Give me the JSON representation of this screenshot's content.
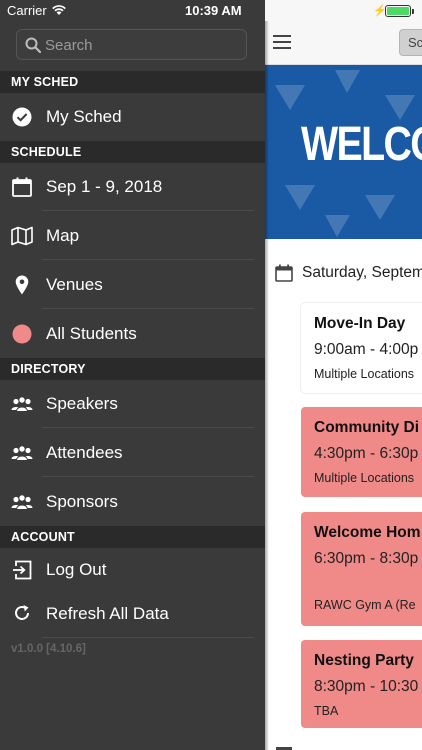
{
  "status_bar": {
    "carrier": "Carrier",
    "time": "10:39 AM",
    "battery_color": "#4cd964"
  },
  "drawer": {
    "search": {
      "placeholder": "Search",
      "icon": "search-icon"
    },
    "sections": {
      "my_sched": {
        "header": "MY SCHED",
        "items": [
          {
            "label": "My Sched",
            "icon": "checkmark-circle-icon"
          }
        ]
      },
      "schedule": {
        "header": "SCHEDULE",
        "items": [
          {
            "label": "Sep 1 - 9, 2018",
            "icon": "calendar-icon"
          },
          {
            "label": "Map",
            "icon": "map-icon"
          },
          {
            "label": "Venues",
            "icon": "location-pin-icon"
          },
          {
            "label": "All Students",
            "icon": "color-dot-icon",
            "dot_color": "#f08a88"
          }
        ]
      },
      "directory": {
        "header": "DIRECTORY",
        "items": [
          {
            "label": "Speakers",
            "icon": "people-icon"
          },
          {
            "label": "Attendees",
            "icon": "people-icon"
          },
          {
            "label": "Sponsors",
            "icon": "people-icon"
          }
        ]
      },
      "account": {
        "header": "ACCOUNT",
        "items": [
          {
            "label": "Log Out",
            "icon": "logout-icon"
          },
          {
            "label": "Refresh All Data",
            "icon": "refresh-icon"
          }
        ]
      }
    },
    "version": "v1.0.0 [4.10.6]"
  },
  "main": {
    "topbar_button": "Sc",
    "banner_text": "WELCO",
    "banner_color": "#1a5aa5",
    "date_label": "Saturday, Septem",
    "events": [
      {
        "title": "Move-In Day",
        "time": "9:00am - 4:00p",
        "location": "Multiple Locations",
        "style": "plain"
      },
      {
        "title": "Community Di",
        "time": "4:30pm - 6:30p",
        "location": "Multiple Locations",
        "style": "red"
      },
      {
        "title": "Welcome Hom",
        "time": "6:30pm - 8:30p",
        "location": "RAWC Gym A (Re",
        "style": "red"
      },
      {
        "title": "Nesting Party",
        "time": "8:30pm - 10:30",
        "location": "TBA",
        "style": "red"
      }
    ],
    "event_color": "#f08a88"
  }
}
